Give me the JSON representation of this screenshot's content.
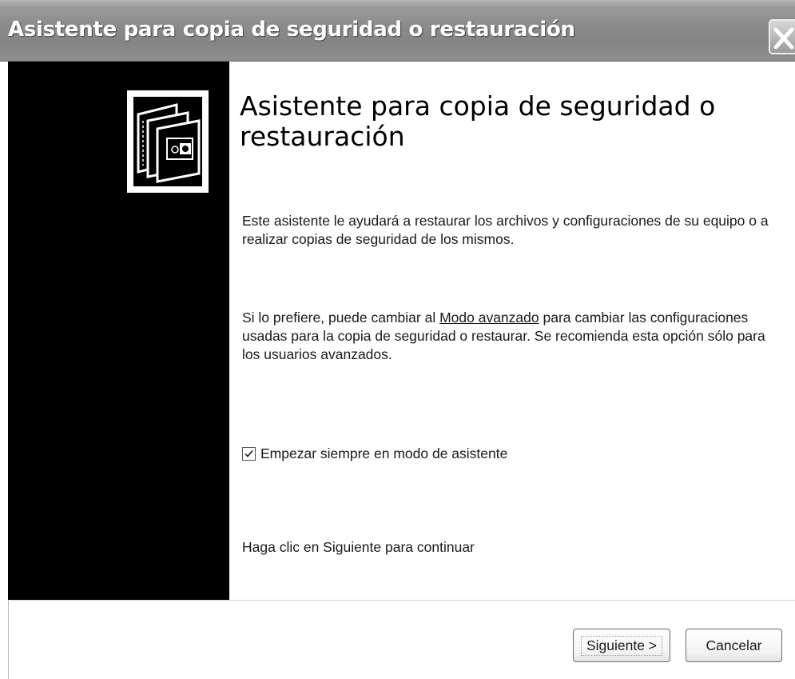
{
  "window": {
    "title": "Asistente para copia de seguridad o restauración",
    "close_icon": "close-x-icon"
  },
  "sidebar": {
    "art_icon": "backup-tape-icon"
  },
  "content": {
    "heading": "Asistente para copia de seguridad o restauración",
    "paragraph1": "Este asistente le ayudará a restaurar los archivos y configuraciones de su equipo o a realizar copias de seguridad de los mismos.",
    "paragraph2_before": "Si lo prefiere, puede cambiar al ",
    "paragraph2_link": "Modo avanzado",
    "paragraph2_after": " para cambiar las configuraciones usadas para la copia de seguridad o restaurar. Se recomienda esta opción sólo para los usuarios avanzados.",
    "checkbox_label": "Empezar siempre en modo de asistente",
    "checkbox_checked": true,
    "continue_text": "Haga clic en Siguiente para continuar"
  },
  "buttons": {
    "next_label": "Siguiente >",
    "cancel_label": "Cancelar"
  }
}
